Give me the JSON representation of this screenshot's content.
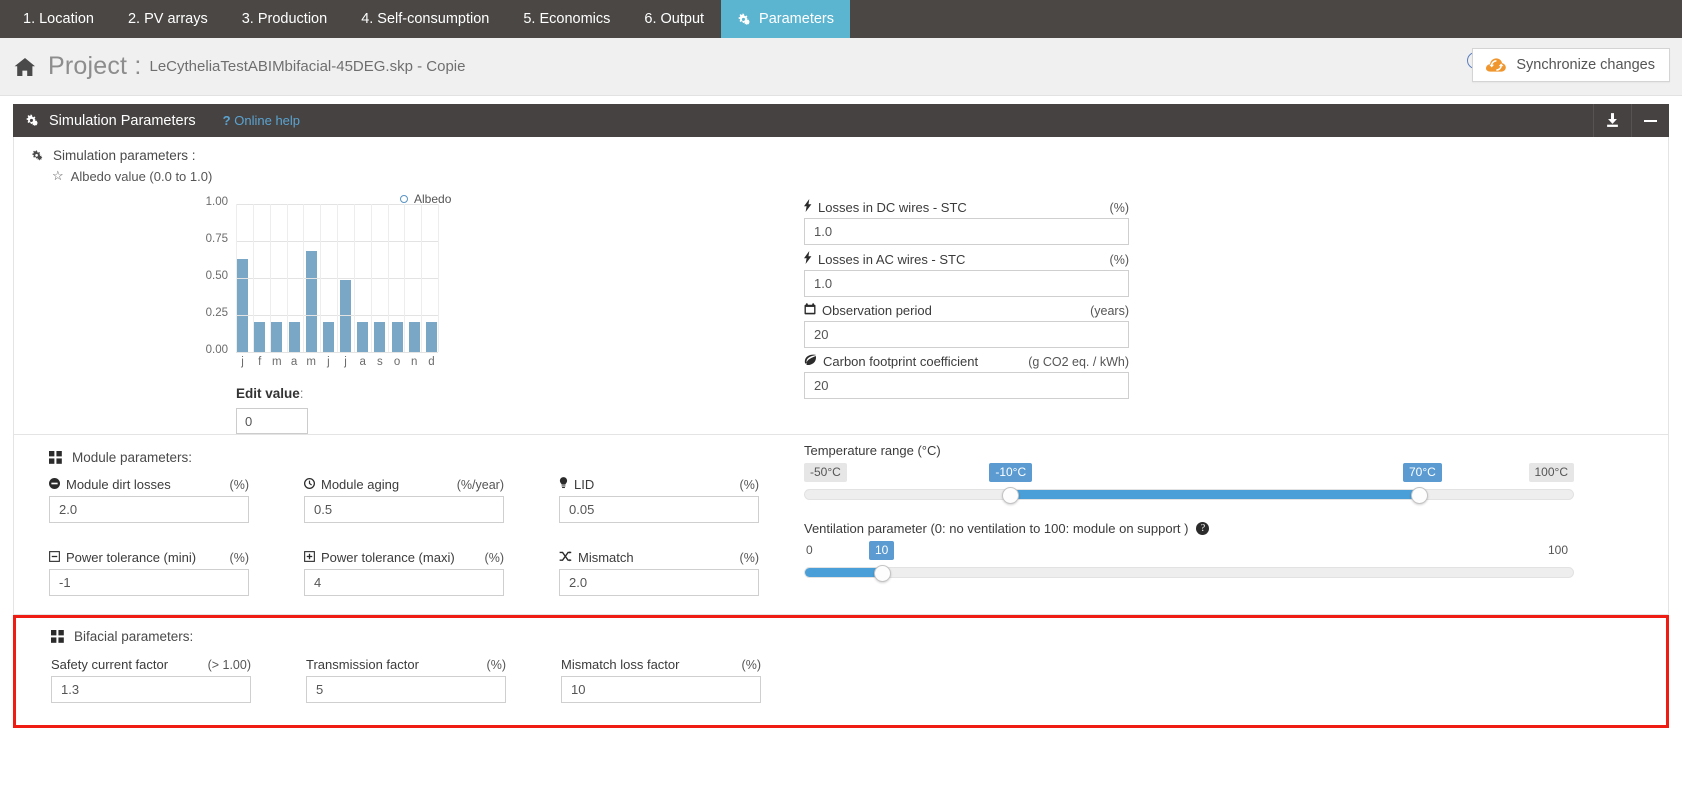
{
  "topnav": {
    "tabs": [
      {
        "label": "1. Location",
        "active": false
      },
      {
        "label": "2. PV arrays",
        "active": false
      },
      {
        "label": "3. Production",
        "active": false
      },
      {
        "label": "4. Self-consumption",
        "active": false
      },
      {
        "label": "5. Economics",
        "active": false
      },
      {
        "label": "6. Output",
        "active": false
      },
      {
        "label": "Parameters",
        "active": true,
        "icon": "gears-icon"
      }
    ],
    "active_color": "#5bb4d0",
    "bg_color": "#4a4744"
  },
  "header": {
    "home_icon": "home-icon",
    "project_label": "Project :",
    "project_name": "LeCytheliaTestABIMbifacial-45DEG.skp - Copie",
    "help_icon_char": "?",
    "sync_button_label": "Synchronize changes",
    "sync_icon": "cloud-sync-icon",
    "sync_icon_color": "#f0962f"
  },
  "panel": {
    "icon": "gears-icon",
    "title": "Simulation Parameters",
    "help_prefix": "?",
    "help_label": "Online help",
    "help_color": "#5ba3d0",
    "actions": [
      {
        "name": "download-icon"
      },
      {
        "name": "minimize-icon"
      }
    ]
  },
  "simulation": {
    "section_title": "Simulation parameters :",
    "section_icon": "gears-icon",
    "albedo_label": "Albedo value (0.0 to 1.0)",
    "albedo_star_icon": "star-icon",
    "edit_value_label": "Edit value",
    "edit_value_colon": ":",
    "edit_value": "0",
    "fields": [
      {
        "icon": "bolt-icon",
        "label": "Losses in DC wires - STC",
        "unit": "(%)",
        "value": "1.0"
      },
      {
        "icon": "bolt-icon",
        "label": "Losses in AC wires - STC",
        "unit": "(%)",
        "value": "1.0"
      },
      {
        "icon": "calendar-icon",
        "label": "Observation period",
        "unit": "(years)",
        "value": "20"
      },
      {
        "icon": "leaf-icon",
        "label": "Carbon footprint coefficient",
        "unit": "(g CO2 eq. / kWh)",
        "value": "20"
      }
    ]
  },
  "chart_data": {
    "type": "bar",
    "title": "",
    "legend": [
      "Albedo"
    ],
    "legend_position": "top-right",
    "categories": [
      "j",
      "f",
      "m",
      "a",
      "m",
      "j",
      "j",
      "a",
      "s",
      "o",
      "n",
      "d"
    ],
    "values": [
      0.63,
      0.2,
      0.2,
      0.2,
      0.68,
      0.2,
      0.485,
      0.2,
      0.2,
      0.2,
      0.2,
      0.2
    ],
    "ylim": [
      0.0,
      1.0
    ],
    "yticks": [
      "0.00",
      "0.25",
      "0.50",
      "0.75",
      "1.00"
    ],
    "ytick_values": [
      0.0,
      0.25,
      0.5,
      0.75,
      1.0
    ],
    "xlabel": "",
    "ylabel": "",
    "grid": true,
    "bar_color": "#7ba7c7",
    "series": [
      {
        "name": "Albedo",
        "values": [
          0.63,
          0.2,
          0.2,
          0.2,
          0.68,
          0.2,
          0.485,
          0.2,
          0.2,
          0.2,
          0.2,
          0.2
        ]
      }
    ]
  },
  "module": {
    "section_title": "Module parameters:",
    "section_icon": "squares-icon",
    "row1": [
      {
        "icon": "minus-circle-icon",
        "label": "Module dirt losses",
        "unit": "(%)",
        "value": "2.0"
      },
      {
        "icon": "clock-icon",
        "label": "Module aging",
        "unit": "(%/year)",
        "value": "0.5"
      },
      {
        "icon": "bulb-icon",
        "label": "LID",
        "unit": "(%)",
        "value": "0.05"
      }
    ],
    "row2": [
      {
        "icon": "minus-square-icon",
        "label": "Power tolerance (mini)",
        "unit": "(%)",
        "value": "-1"
      },
      {
        "icon": "plus-square-icon",
        "label": "Power tolerance (maxi)",
        "unit": "(%)",
        "value": "4"
      },
      {
        "icon": "shuffle-icon",
        "label": "Mismatch",
        "unit": "(%)",
        "value": "2.0"
      }
    ],
    "temperature": {
      "label": "Temperature range (°C)",
      "min_label": "-50°C",
      "max_label": "100°C",
      "low_value": "-10°C",
      "high_value": "70°C",
      "range_min": -50,
      "range_max": 100,
      "low": -10,
      "high": 70,
      "fill_color": "#4a9fd8"
    },
    "ventilation": {
      "label": "Ventilation parameter (0: no ventilation to 100: module on support )",
      "help_icon": "question-circle-icon",
      "min_label": "0",
      "max_label": "100",
      "value_label": "10",
      "range_min": 0,
      "range_max": 100,
      "value": 10,
      "fill_color": "#4a9fd8"
    }
  },
  "bifacial": {
    "section_title": "Bifacial parameters:",
    "section_icon": "squares-icon",
    "highlight_color": "#ee1c12",
    "fields": [
      {
        "label": "Safety current factor",
        "unit": "(> 1.00)",
        "value": "1.3"
      },
      {
        "label": "Transmission factor",
        "unit": "(%)",
        "value": "5"
      },
      {
        "label": "Mismatch loss factor",
        "unit": "(%)",
        "value": "10"
      }
    ]
  }
}
